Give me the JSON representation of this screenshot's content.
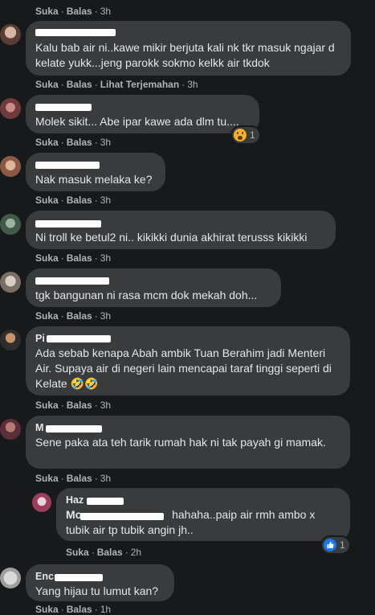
{
  "labels": {
    "like": "Suka",
    "reply": "Balas",
    "see_translation": "Lihat Terjemahan",
    "sep": "·"
  },
  "comments": [
    {
      "time": "3h"
    },
    {
      "text": "Kalu bab air ni..kawe mikir berjuta kali nk tkr masuk ngajar d kelate yukk...jeng parokk sokmo kelkk air tkdok",
      "time": "3h",
      "has_translation": true
    },
    {
      "text": "Molek sikit... Abe ipar kawe ada dlm tu....",
      "time": "3h",
      "reaction": {
        "icon": "wow-emoji-icon",
        "count": "1"
      }
    },
    {
      "text": "Nak masuk melaka ke?",
      "time": "3h"
    },
    {
      "text": "Ni troll ke betul2 ni.. kikikki dunia akhirat terusss kikikki",
      "time": "3h"
    },
    {
      "text": "tgk bangunan ni rasa mcm dok mekah doh...",
      "time": "3h"
    },
    {
      "name_visible": "Pi",
      "text": "Ada sebab kenapa Abah ambik Tuan Berahim jadi Menteri Air. Supaya air di negeri lain mencapai taraf tinggi seperti di Kelate 🤣🤣",
      "time": "3h"
    },
    {
      "name_visible": "M",
      "text": "Sene paka ata teh tarik rumah hak ni tak payah gi mamak.",
      "time": "3h"
    },
    {
      "name_visible": "Haz",
      "mention_visible": "Mo",
      "text": "hahaha..paip air rmh ambo x tubik air tp tubik angin jh..",
      "time": "2h",
      "reaction": {
        "icon": "like-icon",
        "count": "1"
      }
    },
    {
      "name_visible": "Enc",
      "text": "Yang hijau tu lumut kan?",
      "time": "1h"
    }
  ],
  "colors": {
    "bg": "#18191a",
    "bubble": "#3a3b3c",
    "text": "#e4e6eb",
    "muted": "#b0b3b8",
    "like_blue": "#1877f2"
  }
}
